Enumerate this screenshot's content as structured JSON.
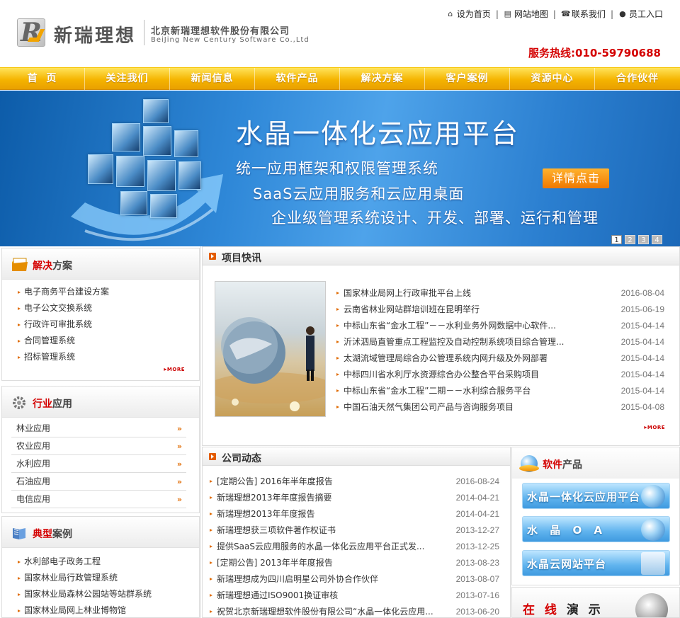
{
  "header": {
    "brand": "新瑞理想",
    "company_cn": "北京新瑞理想软件股份有限公司",
    "company_en": "BeiJing New Century Software Co.,Ltd",
    "top_links": [
      {
        "label": "设为首页",
        "icon": "home-icon"
      },
      {
        "label": "网站地图",
        "icon": "sitemap-icon"
      },
      {
        "label": "联系我们",
        "icon": "phone-icon"
      },
      {
        "label": "员工入口",
        "icon": "user-icon"
      }
    ],
    "hotline": "服务热线:010-59790688"
  },
  "nav": [
    "首  页",
    "关注我们",
    "新闻信息",
    "软件产品",
    "解决方案",
    "客户案例",
    "资源中心",
    "合作伙伴"
  ],
  "banner": {
    "title": "水晶一体化云应用平台",
    "lines": [
      "统一应用框架和权限管理系统",
      "SaaS云应用服务和云应用桌面",
      "企业级管理系统设计、开发、部署、运行和管理"
    ],
    "button": "详情点击",
    "pages": [
      "1",
      "2",
      "3",
      "4"
    ]
  },
  "solutions": {
    "title_em": "解决",
    "title_rest": "方案",
    "items": [
      "电子商务平台建设方案",
      "电子公文交换系统",
      "行政许可审批系统",
      "合同管理系统",
      "招标管理系统"
    ],
    "more": "MORE"
  },
  "industry": {
    "title_em": "行业",
    "title_rest": "应用",
    "items": [
      "林业应用",
      "农业应用",
      "水利应用",
      "石油应用",
      "电信应用"
    ],
    "arrow": "»"
  },
  "cases": {
    "title_em": "典型",
    "title_rest": "案例",
    "items": [
      "水利部电子政务工程",
      "国家林业局行政管理系统",
      "国家林业局森林公园站等站群系统",
      "国家林业局网上林业博物馆"
    ]
  },
  "project_news": {
    "title": "项目快讯",
    "items": [
      {
        "text": "国家林业局网上行政审批平台上线",
        "date": "2016-08-04"
      },
      {
        "text": "云南省林业网站群培训班在昆明举行",
        "date": "2015-06-19"
      },
      {
        "text": "中标山东省“金水工程”－－水利业务外网数据中心软件...",
        "date": "2015-04-14"
      },
      {
        "text": "沂沭泗局直管重点工程监控及自动控制系统项目综合管理...",
        "date": "2015-04-14"
      },
      {
        "text": "太湖流域管理局综合办公管理系统内网升级及外网部署",
        "date": "2015-04-14"
      },
      {
        "text": "中标四川省水利厅水资源综合办公整合平台采购项目",
        "date": "2015-04-14"
      },
      {
        "text": "中标山东省“金水工程”二期－－水利综合服务平台",
        "date": "2015-04-14"
      },
      {
        "text": "中国石油天然气集团公司产品与咨询服务项目",
        "date": "2015-04-08"
      }
    ],
    "more": "MORE"
  },
  "company_news": {
    "title": "公司动态",
    "items": [
      {
        "text": "[定期公告] 2016年半年度报告",
        "date": "2016-08-24"
      },
      {
        "text": "新瑞理想2013年年度报告摘要",
        "date": "2014-04-21"
      },
      {
        "text": "新瑞理想2013年年度报告",
        "date": "2014-04-21"
      },
      {
        "text": "新瑞理想获三项软件著作权证书",
        "date": "2013-12-27"
      },
      {
        "text": "提供SaaS云应用服务的水晶一体化云应用平台正式发...",
        "date": "2013-12-25"
      },
      {
        "text": "[定期公告] 2013年半年度报告",
        "date": "2013-08-23"
      },
      {
        "text": "新瑞理想成为四川启明星公司外协合作伙伴",
        "date": "2013-08-07"
      },
      {
        "text": "新瑞理想通过ISO9001换证审核",
        "date": "2013-07-16"
      },
      {
        "text": "祝贺北京新瑞理想软件股份有限公司“水晶一体化云应用...",
        "date": "2013-06-20"
      }
    ]
  },
  "products": {
    "title_em": "软件",
    "title_rest": "产品",
    "items": [
      "水晶一体化云应用平台",
      "水 晶 O A",
      "水晶云网站平台"
    ]
  },
  "online": {
    "em": "在 线",
    "rest": "演 示"
  },
  "colors": {
    "accent": "#f5b400",
    "red": "#d40000",
    "orange": "#e06a00",
    "banner": "#2f88d8"
  }
}
